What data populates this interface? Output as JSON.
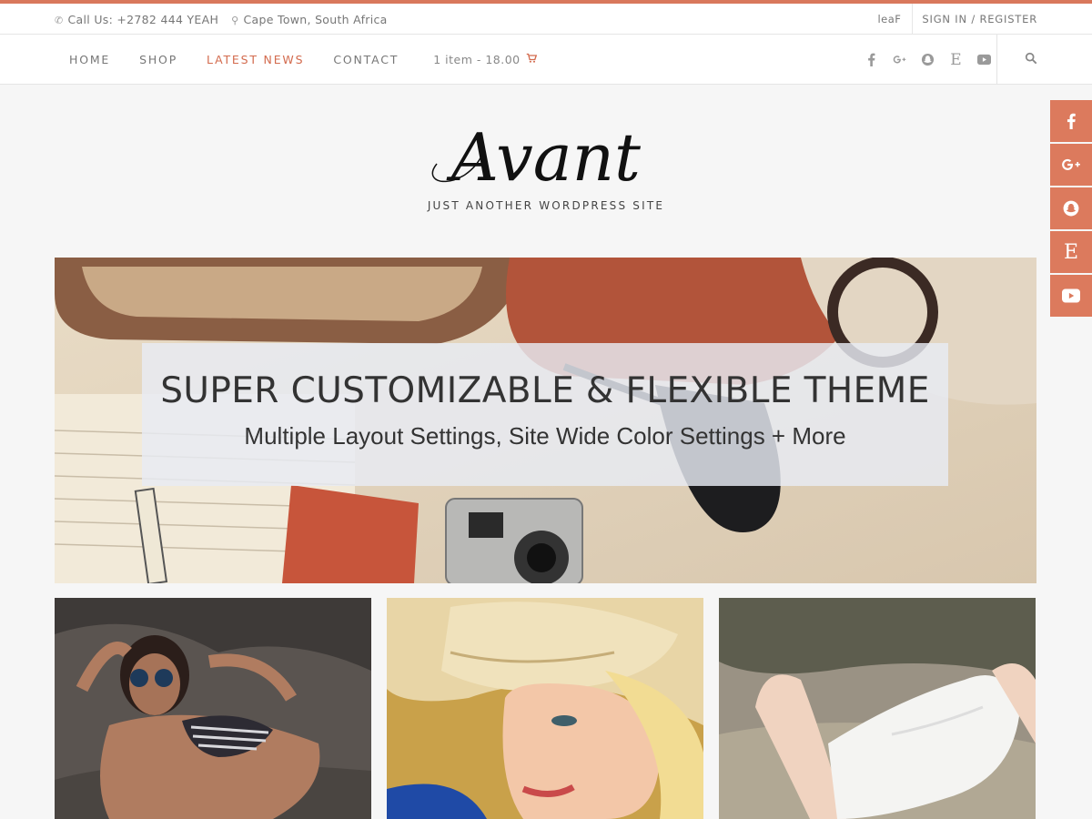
{
  "colors": {
    "accent": "#d9785c",
    "active_nav": "#d36b4e",
    "side_social_bg": "#dc7a5d"
  },
  "topbar": {
    "phone_icon": "phone-icon",
    "phone": "Call Us: +2782 444 YEAH",
    "location_icon": "map-pin-icon",
    "location": "Cape Town, South Africa",
    "user": "leaF",
    "sign_in": "SIGN IN / REGISTER"
  },
  "nav": {
    "items": [
      {
        "label": "HOME",
        "active": false
      },
      {
        "label": "SHOP",
        "active": false
      },
      {
        "label": "LATEST NEWS",
        "active": true
      },
      {
        "label": "CONTACT",
        "active": false
      }
    ],
    "cart": "1 item - 18.00",
    "cart_icon": "cart-icon",
    "social": [
      "facebook-icon",
      "google-plus-icon",
      "snapchat-icon",
      "etsy-icon",
      "youtube-icon"
    ],
    "search_icon": "search-icon"
  },
  "side_social": [
    "facebook-icon",
    "google-plus-icon",
    "snapchat-icon",
    "etsy-icon",
    "youtube-icon"
  ],
  "brand": {
    "logo": "Avant",
    "tagline": "JUST ANOTHER WORDPRESS SITE"
  },
  "hero": {
    "title": "SUPER CUSTOMIZABLE & FLEXIBLE THEME",
    "subtitle": "Multiple Layout Settings, Site Wide Color Settings + More"
  },
  "posts": [
    {
      "image": "woman-sunglasses-on-rocks"
    },
    {
      "image": "woman-straw-hat"
    },
    {
      "image": "woman-white-dress"
    }
  ]
}
